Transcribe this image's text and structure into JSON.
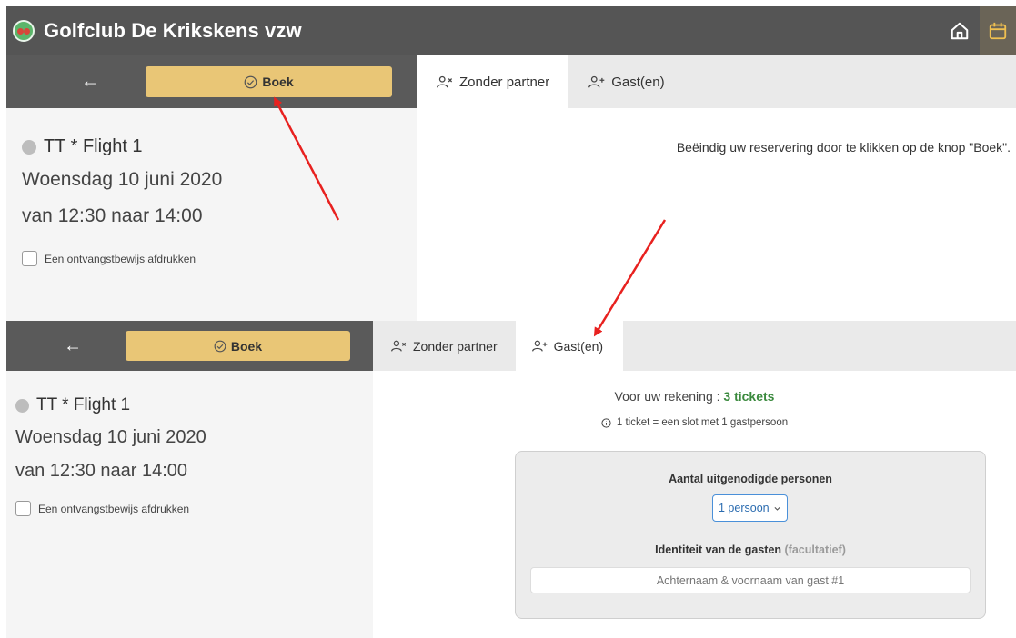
{
  "header": {
    "title": "Golfclub De Krikskens vzw",
    "home_icon": "home-icon",
    "calendar_icon": "calendar-icon"
  },
  "top_panel": {
    "back_icon": "←",
    "boek_label": "Boek",
    "flight": "TT * Flight 1",
    "date": "Woensdag 10 juni 2020",
    "time": "van 12:30 naar 14:00",
    "receipt_label": "Een ontvangstbewijs afdrukken",
    "tabs": [
      {
        "label": "Zonder partner",
        "active": true
      },
      {
        "label": "Gast(en)",
        "active": false
      }
    ],
    "message": "Beëindig uw reservering door te klikken op de knop \"Boek\"."
  },
  "bottom_panel": {
    "back_icon": "←",
    "boek_label": "Boek",
    "flight": "TT * Flight 1",
    "date": "Woensdag 10 juni 2020",
    "time": "van 12:30 naar 14:00",
    "receipt_label": "Een ontvangstbewijs afdrukken",
    "tabs": [
      {
        "label": "Zonder partner",
        "active": false
      },
      {
        "label": "Gast(en)",
        "active": true
      }
    ],
    "account_label": "Voor uw rekening : ",
    "account_value": "3 tickets",
    "ticket_info": "1 ticket = een slot met 1 gastpersoon",
    "guests_title": "Aantal uitgenodigde personen",
    "guests_select_value": "1 persoon",
    "identity_title": "Identiteit van de gasten",
    "identity_optional": "(facultatief)",
    "guest_placeholder": "Achternaam & voornaam van gast #1"
  },
  "colors": {
    "header_bg": "#555555",
    "boek_bg": "#e9c676",
    "accent_green": "#3b8a3e",
    "select_border": "#4a90d9",
    "annotation_arrow": "#e8211f"
  }
}
